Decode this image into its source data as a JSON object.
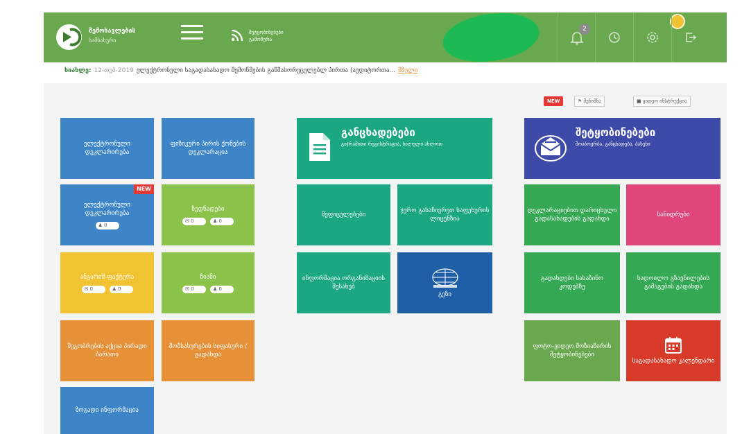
{
  "header": {
    "logo_title": "შემოსავლების",
    "logo_subtitle": "სამსახური",
    "rss_line1": "შეტყობინებები",
    "rss_line2": "გამოწერა",
    "notification_count": "2",
    "colors": {
      "header_bg": "#6aa84f",
      "accent": "#1db954"
    }
  },
  "news": {
    "label": "სიახლე:",
    "date": "12-თებ-2019",
    "text": "ელექტრონული საგადასახადო შემოწმების გაწმასორეცულებლ პირთა (აუდიტორთა...",
    "more": "მზული"
  },
  "toolbar": {
    "new_tag": "NEW",
    "btn_instructions": "შენიშნა",
    "btn_video": "ვიდეო ინსტრუქცია"
  },
  "tiles": {
    "e_declaration": "ელექტრონული დეკლარირება",
    "individual_declaration": "ფიზიკური პირის ქონების დეკლარაცია",
    "e_declaration_new": "ელექტრონული დეკლარირება",
    "new_corner": "NEW",
    "e_decl_new_count": "0",
    "sender": "ზედნადები",
    "sender_count_a": "0",
    "sender_count_b": "0",
    "invoice": "ანგარიშ-ფაქტურა",
    "invoice_count_a": "0",
    "invoice_count_b": "0",
    "waybill": "ზიანი",
    "waybill_count_a": "0",
    "waybill_count_b": "0",
    "auction": "მეგობრების აქცია პირადი ბარათი",
    "property_reg": "შომსახურების სიფასური / გადახდა",
    "general_info": "ზოგადი ინფორმაცია",
    "applications_title": "განცხადებები",
    "applications_sub": "გიჯრამითი რეგისტრაცია, ხილული ახლოთ",
    "documents": "შეფიცულებები",
    "single_window": "ჯერო გასაჩივრეთ საფეხურის ლიცენზია",
    "info_org": "ინფორმაცია ორგანიზაციის შესახებ",
    "map": "გეზი",
    "messages_title": "შეტყობინებები",
    "messages_sub": "შოაბოვრბა, განცხადება, პასუხი",
    "decl_delayed": "დეკლარაციებით დარიცხული გადასახადების გადახდა",
    "fines": "სანიდრები",
    "tax_code": "გადახდები სახაზინო კოდებზე",
    "tax_payer": "სადოილო გზავნილების გამაგების გადახდა",
    "photo_video": "ფოტო-ვიდეო შოზიაზირის შეტყობინებები",
    "tax_calendar": "საგადასახადო კალენდარი"
  }
}
